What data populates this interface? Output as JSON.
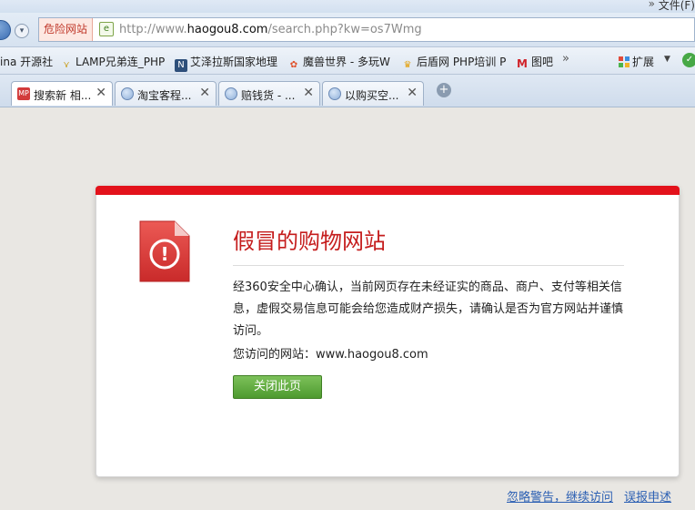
{
  "titlebar": {
    "menu_file": "文件(F)",
    "chevron": "»"
  },
  "address_bar": {
    "danger_label": "危险网站",
    "url_domain": "http://www.",
    "url_host": "haogou8.com",
    "url_path": "/search.php?kw=os7Wmg"
  },
  "favorites": {
    "items": [
      {
        "label": "ina 开源社",
        "icon": "page-icon"
      },
      {
        "label": "LAMP兄弟连_PHP",
        "icon": "wings-icon"
      },
      {
        "label": "艾泽拉斯国家地理",
        "icon": "ngacn-icon"
      },
      {
        "label": "魔兽世界 - 多玩W",
        "icon": "flower-icon"
      },
      {
        "label": "后盾网 PHP培训 P",
        "icon": "trophy-icon"
      },
      {
        "label": "图吧",
        "icon": "m-logo-icon"
      }
    ],
    "more": "»",
    "extensions_label": "扩展"
  },
  "tabs": [
    {
      "label": "搜索新 相...",
      "icon": "mp-icon",
      "close": "✕"
    },
    {
      "label": "淘宝客程...",
      "icon": "ie-icon",
      "close": "✕"
    },
    {
      "label": "赔钱货 - ...",
      "icon": "ie-icon",
      "close": "✕"
    },
    {
      "label": "以购买空...",
      "icon": "ie-icon",
      "close": "✕"
    }
  ],
  "new_tab": "+",
  "warning": {
    "title": "假冒的购物网站",
    "body": "经360安全中心确认，当前网页存在未经证实的商品、商户、支付等相关信息，虚假交易信息可能会给您造成财产损失，请确认是否为官方网站并谨慎访问。",
    "visit_prefix": "您访问的网站：",
    "visit_site": "www.haogou8.com",
    "close_button": "关闭此页",
    "icon_glyph": "!"
  },
  "footer": {
    "ignore_link": "忽略警告，继续访问",
    "report_link": "误报申述"
  },
  "colors": {
    "danger_red": "#e3121b",
    "title_red": "#c51d1d",
    "button_green": "#5aa83a",
    "link_blue": "#2b5fb3",
    "page_bg": "#e9e7e3"
  }
}
